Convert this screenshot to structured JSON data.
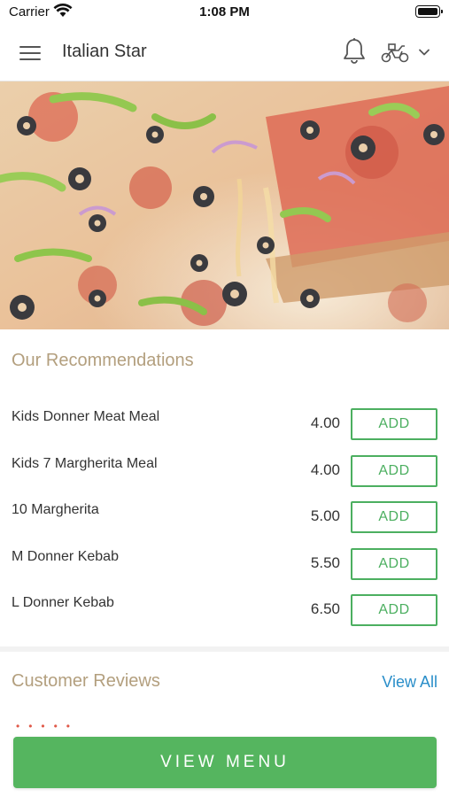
{
  "status_bar": {
    "carrier": "Carrier",
    "time": "1:08 PM"
  },
  "header": {
    "title": "Italian Star",
    "icons": [
      "menu-icon",
      "bell-icon",
      "scooter-icon",
      "chevron-down-icon"
    ]
  },
  "recommendations": {
    "title": "Our Recommendations",
    "items": [
      {
        "name": "Kids Donner Meat  Meal",
        "price": "4.00",
        "button": "ADD"
      },
      {
        "name": "Kids 7 Margherita Meal",
        "price": "4.00",
        "button": "ADD"
      },
      {
        "name": "10 Margherita",
        "price": "5.00",
        "button": "ADD"
      },
      {
        "name": "M Donner Kebab",
        "price": "5.50",
        "button": "ADD"
      },
      {
        "name": "L Donner Kebab",
        "price": "6.50",
        "button": "ADD"
      }
    ]
  },
  "reviews": {
    "title": "Customer Reviews",
    "view_all": "View All"
  },
  "footer": {
    "view_menu": "VIEW MENU"
  },
  "colors": {
    "accent_green": "#55b55f",
    "section_title": "#b39f7e",
    "link_blue": "#2a8ec9"
  }
}
